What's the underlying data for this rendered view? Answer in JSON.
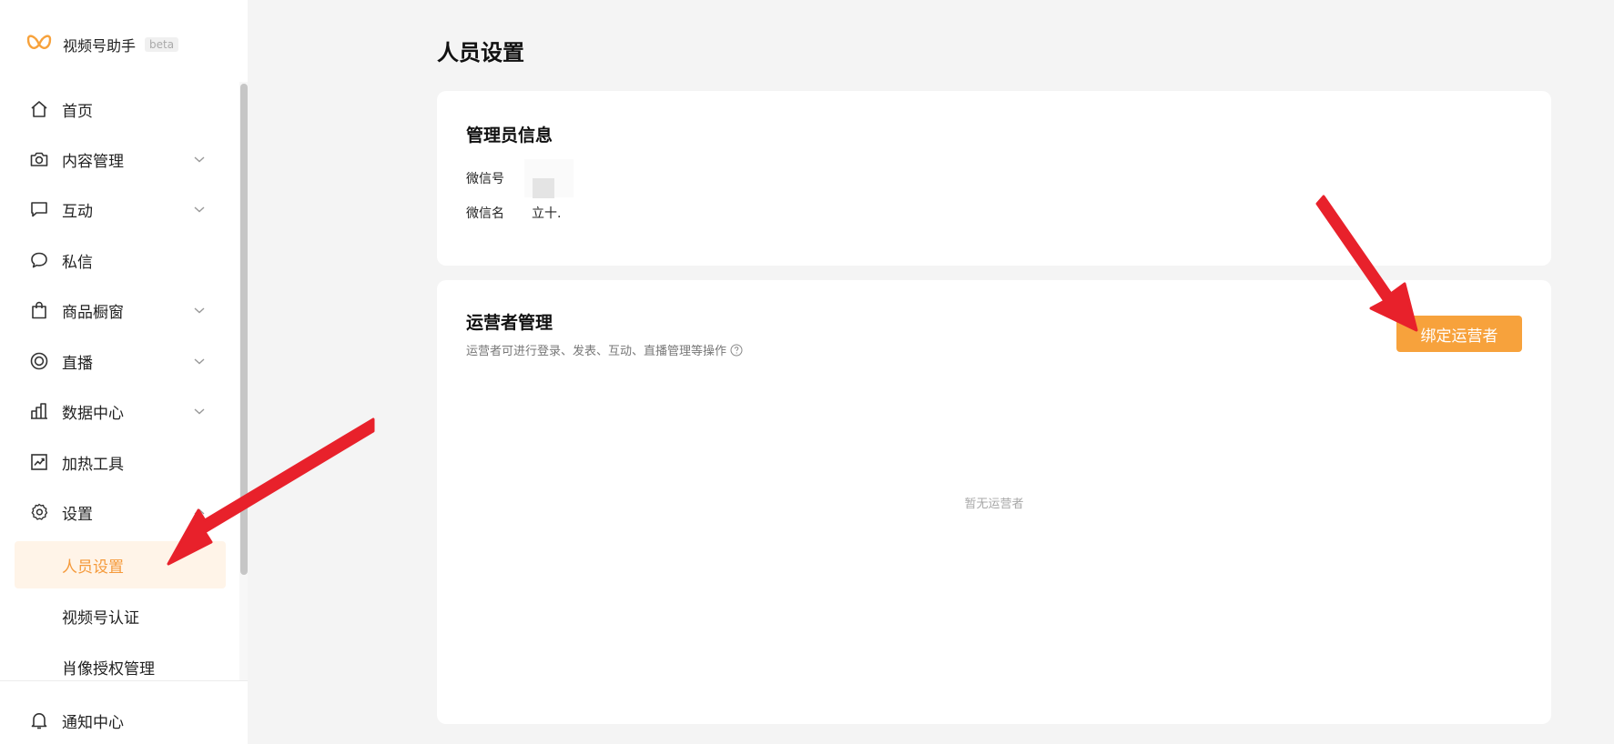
{
  "brand": {
    "name": "视频号助手",
    "tag": "beta",
    "logo_icon": "butterfly-logo",
    "accent": "#f7a23c"
  },
  "nav": {
    "items": [
      {
        "label": "首页",
        "icon": "home-icon",
        "has_children": false
      },
      {
        "label": "内容管理",
        "icon": "camera-icon",
        "has_children": true
      },
      {
        "label": "互动",
        "icon": "message-square-icon",
        "has_children": true
      },
      {
        "label": "私信",
        "icon": "chat-bubble-icon",
        "has_children": false
      },
      {
        "label": "商品橱窗",
        "icon": "shopping-bag-icon",
        "has_children": true
      },
      {
        "label": "直播",
        "icon": "live-circle-icon",
        "has_children": true
      },
      {
        "label": "数据中心",
        "icon": "bar-chart-icon",
        "has_children": true
      },
      {
        "label": "加热工具",
        "icon": "trend-chart-icon",
        "has_children": false
      },
      {
        "label": "设置",
        "icon": "gear-icon",
        "has_children": true
      }
    ],
    "settings_children": [
      {
        "label": "人员设置",
        "active": true
      },
      {
        "label": "视频号认证",
        "active": false
      },
      {
        "label": "肖像授权管理",
        "active": false
      }
    ],
    "notify": {
      "label": "通知中心",
      "icon": "bell-icon"
    }
  },
  "page": {
    "title": "人员设置",
    "admin_card": {
      "title": "管理员信息",
      "wechat_id_label": "微信号",
      "wechat_name_label": "微信名",
      "wechat_name_value": "立十."
    },
    "operator_card": {
      "title": "运营者管理",
      "subtitle": "运营者可进行登录、发表、互动、直播管理等操作",
      "bind_button": "绑定运营者",
      "empty_text": "暂无运营者"
    }
  },
  "colors": {
    "active_bg": "#fff4e8",
    "active_text": "#f59a3b",
    "annotation_arrow": "#e8212b"
  }
}
